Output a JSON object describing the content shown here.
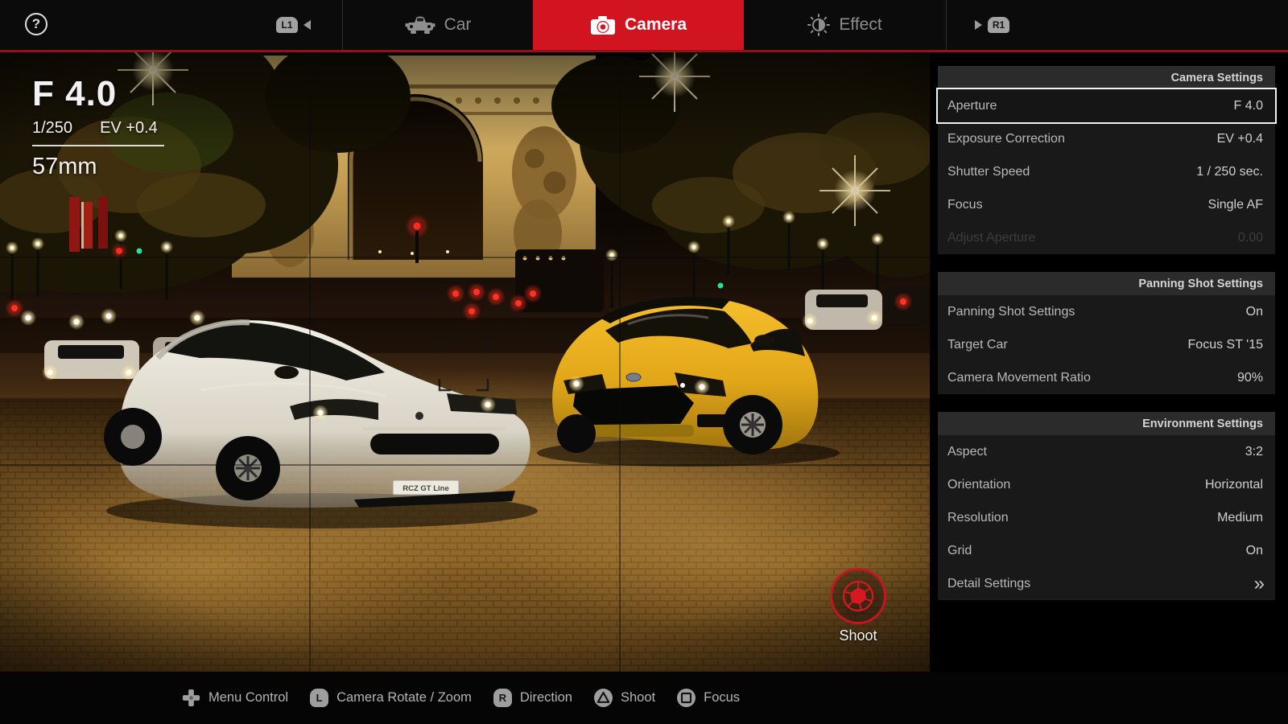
{
  "topbar": {
    "help_label": "?",
    "l1_label": "L1",
    "r1_label": "R1",
    "tabs": [
      {
        "label": "Car",
        "active": false
      },
      {
        "label": "Camera",
        "active": true
      },
      {
        "label": "Effect",
        "active": false
      }
    ]
  },
  "viewport": {
    "aperture": "F 4.0",
    "shutter": "1/250",
    "exposure": "EV +0.4",
    "focal_length": "57mm",
    "license_plate": "RCZ GT Line",
    "shoot_label": "Shoot"
  },
  "panels": [
    {
      "title": "Camera Settings",
      "rows": [
        {
          "label": "Aperture",
          "value": "F 4.0",
          "state": "selected"
        },
        {
          "label": "Exposure Correction",
          "value": "EV +0.4",
          "state": "normal"
        },
        {
          "label": "Shutter Speed",
          "value": "1 / 250 sec.",
          "state": "normal"
        },
        {
          "label": "Focus",
          "value": "Single AF",
          "state": "normal"
        },
        {
          "label": "Adjust Aperture",
          "value": "0.00",
          "state": "disabled"
        }
      ]
    },
    {
      "title": "Panning Shot Settings",
      "rows": [
        {
          "label": "Panning Shot Settings",
          "value": "On",
          "state": "normal"
        },
        {
          "label": "Target Car",
          "value": "Focus ST '15",
          "state": "normal"
        },
        {
          "label": "Camera Movement Ratio",
          "value": "90%",
          "state": "normal"
        }
      ]
    },
    {
      "title": "Environment Settings",
      "rows": [
        {
          "label": "Aspect",
          "value": "3:2",
          "state": "normal"
        },
        {
          "label": "Orientation",
          "value": "Horizontal",
          "state": "normal"
        },
        {
          "label": "Resolution",
          "value": "Medium",
          "state": "normal"
        },
        {
          "label": "Grid",
          "value": "On",
          "state": "normal"
        },
        {
          "label": "Detail Settings",
          "value": "»",
          "state": "normal"
        }
      ]
    }
  ],
  "bottombar": {
    "hints": [
      {
        "icon": "dpad-icon",
        "label": "Menu Control"
      },
      {
        "icon": "left-stick-icon",
        "key": "L",
        "label": "Camera Rotate / Zoom"
      },
      {
        "icon": "right-stick-icon",
        "key": "R",
        "label": "Direction"
      },
      {
        "icon": "triangle-button-icon",
        "label": "Shoot"
      },
      {
        "icon": "square-button-icon",
        "label": "Focus"
      }
    ]
  },
  "colors": {
    "accent_red": "#d21420",
    "topbar_underline_red": "#931117",
    "panel_header_bg": "#2b2b2b",
    "panel_row_bg": "#191919",
    "selected_border": "#f2f2f2",
    "shoot_ring_red": "#c41520"
  }
}
